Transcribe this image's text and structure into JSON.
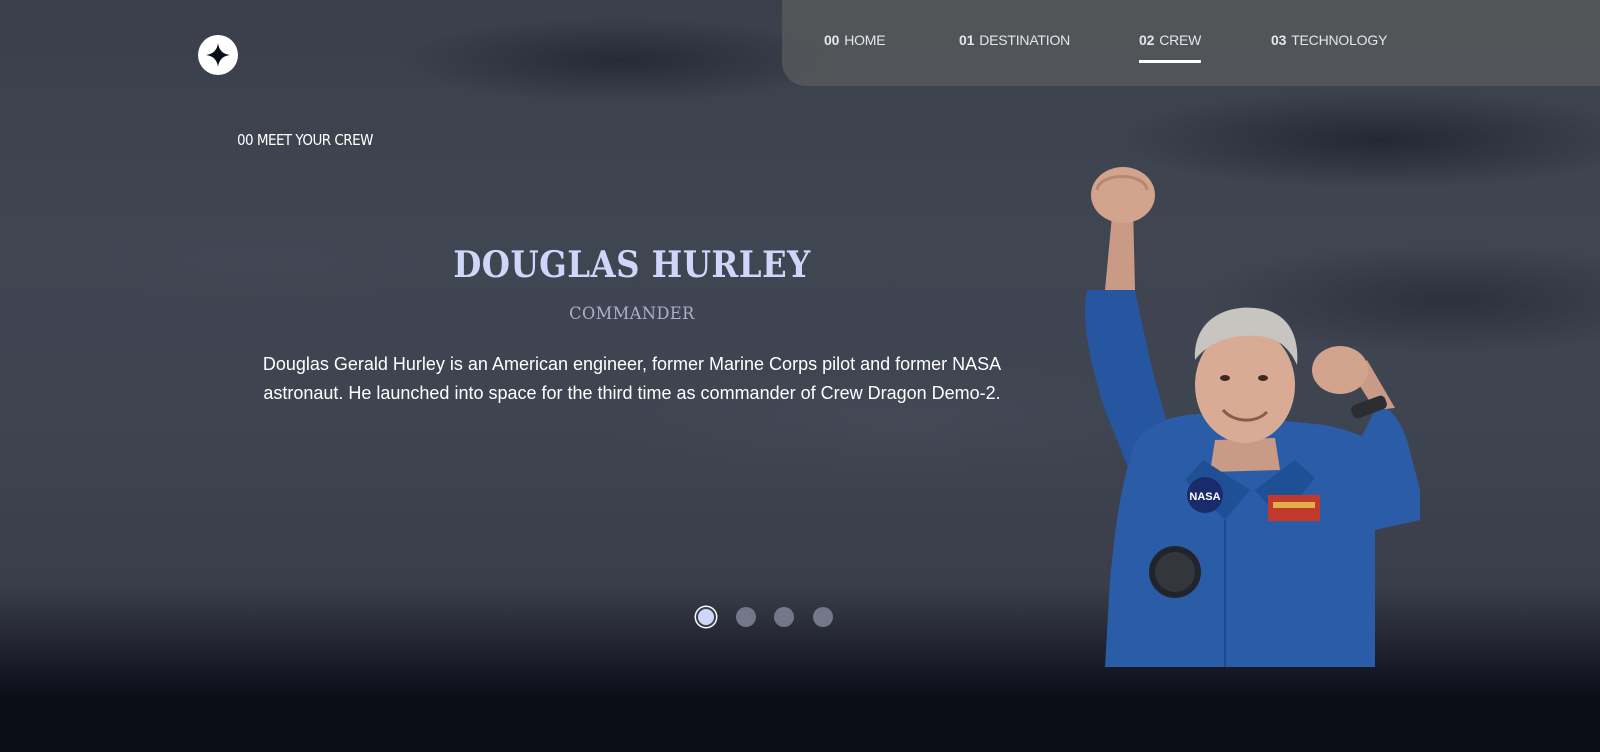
{
  "nav": {
    "items": [
      {
        "num": "00",
        "label": "HOME"
      },
      {
        "num": "01",
        "label": "DESTINATION"
      },
      {
        "num": "02",
        "label": "CREW"
      },
      {
        "num": "03",
        "label": "TECHNOLOGY"
      }
    ],
    "active_index": 2
  },
  "page": {
    "eyebrow": "00 MEET YOUR CREW"
  },
  "crew": {
    "name": "DOUGLAS HURLEY",
    "role": "COMMANDER",
    "bio": "Douglas Gerald Hurley is an American engineer, former Marine Corps pilot and former NASA astronaut. He launched into space for the third time as commander of Crew Dragon Demo-2.",
    "photo_icon": "astronaut-photo"
  },
  "carousel": {
    "count": 4,
    "active_index": 0
  },
  "colors": {
    "accent": "#d0d6f9",
    "background": "#0b0d17",
    "nav_bg": "#5a5a5c"
  }
}
